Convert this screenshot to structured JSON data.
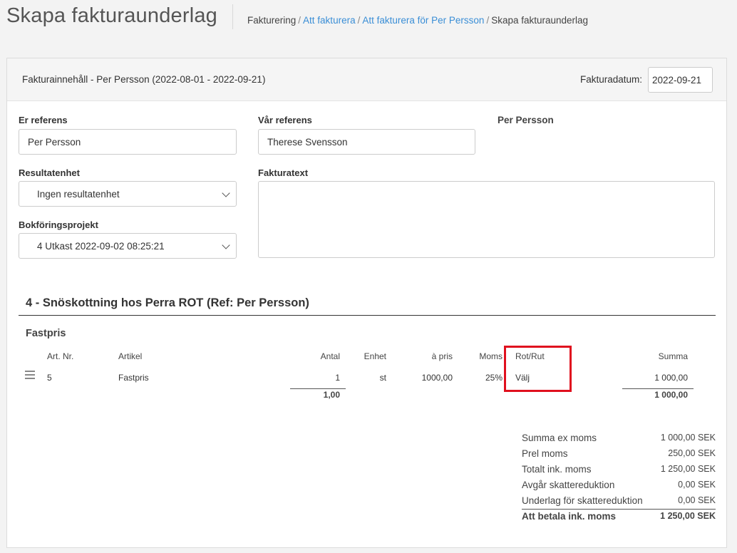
{
  "header": {
    "title": "Skapa fakturaunderlag",
    "breadcrumb": [
      {
        "label": "Fakturering",
        "link": false
      },
      {
        "label": "Att fakturera",
        "link": true
      },
      {
        "label": "Att fakturera för Per Persson",
        "link": true
      },
      {
        "label": "Skapa fakturaunderlag",
        "link": false
      }
    ],
    "breadcrumb_separator": "/"
  },
  "panel": {
    "title": "Fakturainnehåll - Per Persson (2022-08-01 - 2022-09-21)",
    "invoice_date_label": "Fakturadatum:",
    "invoice_date_value": "2022-09-21"
  },
  "form": {
    "your_ref_label": "Er referens",
    "your_ref_value": "Per Persson",
    "our_ref_label": "Vår referens",
    "our_ref_value": "Therese Svensson",
    "customer_name": "Per Persson",
    "result_unit_label": "Resultatenhet",
    "result_unit_value": "Ingen resultatenhet",
    "invoice_text_label": "Fakturatext",
    "invoice_text_value": "",
    "project_label": "Bokföringsprojekt",
    "project_value": "4 Utkast 2022-09-02 08:25:21"
  },
  "section": {
    "title": "4 - Snöskottning hos Perra ROT (Ref: Per Persson)",
    "group_title": "Fastpris",
    "columns": {
      "art_nr": "Art. Nr.",
      "article": "Artikel",
      "qty": "Antal",
      "unit": "Enhet",
      "price": "à pris",
      "vat": "Moms",
      "rot_rut": "Rot/Rut",
      "sum": "Summa"
    },
    "rows": [
      {
        "art_nr": "5",
        "article": "Fastpris",
        "qty": "1",
        "unit": "st",
        "price": "1000,00",
        "vat": "25%",
        "rot_rut": "Välj",
        "sum": "1 000,00"
      }
    ],
    "totals": {
      "qty": "1,00",
      "sum": "1 000,00"
    }
  },
  "summary": [
    {
      "label": "Summa ex moms",
      "value": "1 000,00 SEK"
    },
    {
      "label": "Prel moms",
      "value": "250,00 SEK"
    },
    {
      "label": "Totalt ink. moms",
      "value": "1 250,00 SEK"
    },
    {
      "label": "Avgår skattereduktion",
      "value": "0,00 SEK"
    },
    {
      "label": "Underlag för skattereduktion",
      "value": "0,00 SEK"
    }
  ],
  "summary_total": {
    "label": "Att betala ink. moms",
    "value": "1 250,00 SEK"
  },
  "colors": {
    "link": "#3a8ed6",
    "highlight": "#e0101e",
    "panel_header_bg": "#f5f5f5"
  },
  "icons": {
    "row_handle": "drag-handle-icon",
    "select_arrow": "chevron-down-icon"
  }
}
